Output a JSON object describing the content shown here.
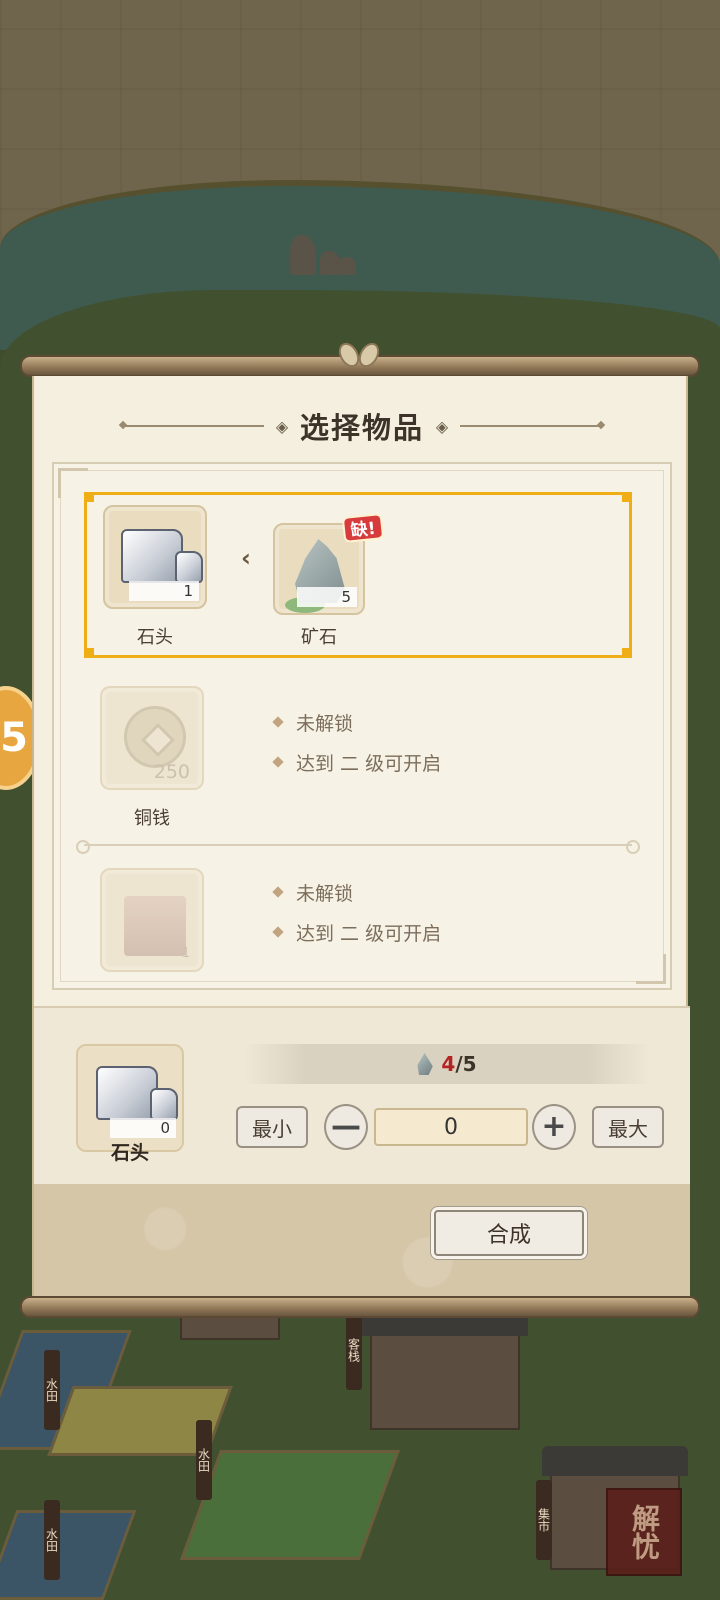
{
  "dialog": {
    "title": "选择物品"
  },
  "recipes": [
    {
      "selected": true,
      "output": {
        "name": "石头",
        "count": "1"
      },
      "input": {
        "name": "矿石",
        "count": "5",
        "badge": "缺!"
      }
    },
    {
      "selected": false,
      "output": {
        "name": "铜钱",
        "count": "250"
      },
      "locked": true,
      "lock_lines": [
        "未解锁",
        "达到 二 级可开启"
      ]
    },
    {
      "selected": false,
      "output": {
        "name": "",
        "count": "1"
      },
      "locked": true,
      "lock_lines": [
        "未解锁",
        "达到 二 级可开启"
      ]
    }
  ],
  "craft": {
    "item_name": "石头",
    "item_count": "0",
    "have": "4",
    "need": "/5",
    "min_label": "最小",
    "max_label": "最大",
    "minus_label": "—",
    "plus_label": "+",
    "quantity": "0",
    "button_label": "合成"
  },
  "map_signs": [
    "客栈",
    "水田",
    "水田",
    "水田",
    "集市"
  ],
  "corner_stamp": "解忧",
  "colors": {
    "selected_border": "#f0ae16",
    "missing_badge": "#d83b3b",
    "have_count": "#b52424"
  }
}
